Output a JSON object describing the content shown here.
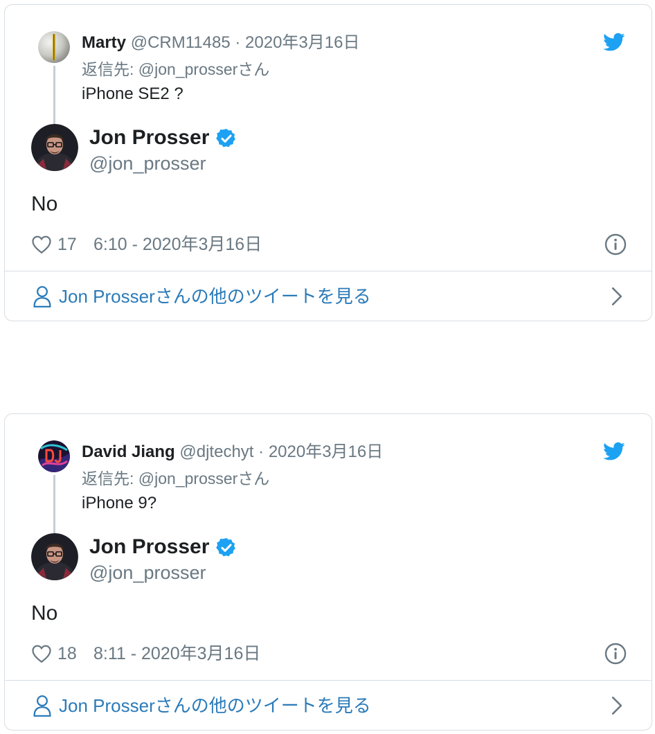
{
  "tweets": [
    {
      "parent": {
        "name": "Marty",
        "handle": "@CRM11485",
        "separator": "·",
        "date": "2020年3月16日",
        "reply_to": "返信先: @jon_prosserさん",
        "text": "iPhone SE2 ?",
        "avatar_style": "grey-gold-sphere"
      },
      "author": {
        "name": "Jon Prosser",
        "handle": "@jon_prosser",
        "verified": true
      },
      "text": "No",
      "likes": "17",
      "time": "6:10 - 2020年3月16日",
      "more_label": "Jon Prosserさんの他のツイートを見る"
    },
    {
      "parent": {
        "name": "David Jiang",
        "handle": "@djtechyt",
        "separator": "·",
        "date": "2020年3月16日",
        "reply_to": "返信先: @jon_prosserさん",
        "text": "iPhone 9?",
        "avatar_style": "neon-dj"
      },
      "author": {
        "name": "Jon Prosser",
        "handle": "@jon_prosser",
        "verified": true
      },
      "text": "No",
      "likes": "18",
      "time": "8:11 - 2020年3月16日",
      "more_label": "Jon Prosserさんの他のツイートを見る"
    }
  ],
  "icons": {
    "brand": "twitter-bird-icon",
    "like": "heart-icon",
    "info": "info-icon",
    "profile": "person-icon",
    "more": "chevron-right-icon",
    "verified": "verified-badge-icon"
  },
  "colors": {
    "twitter_blue": "#1da1f2",
    "link_blue": "#2b7bb9",
    "muted": "#697882",
    "border": "#d6dde3"
  }
}
